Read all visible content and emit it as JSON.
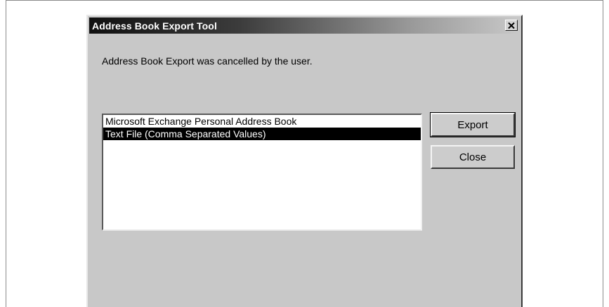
{
  "dialog": {
    "title": "Address Book Export Tool",
    "message": "Address Book Export was cancelled by the user.",
    "close_icon": "close-icon",
    "list": {
      "items": [
        {
          "label": "Microsoft Exchange Personal Address Book",
          "selected": false
        },
        {
          "label": "Text File (Comma Separated Values)",
          "selected": true
        }
      ]
    },
    "buttons": {
      "export_label": "Export",
      "close_label": "Close"
    }
  }
}
